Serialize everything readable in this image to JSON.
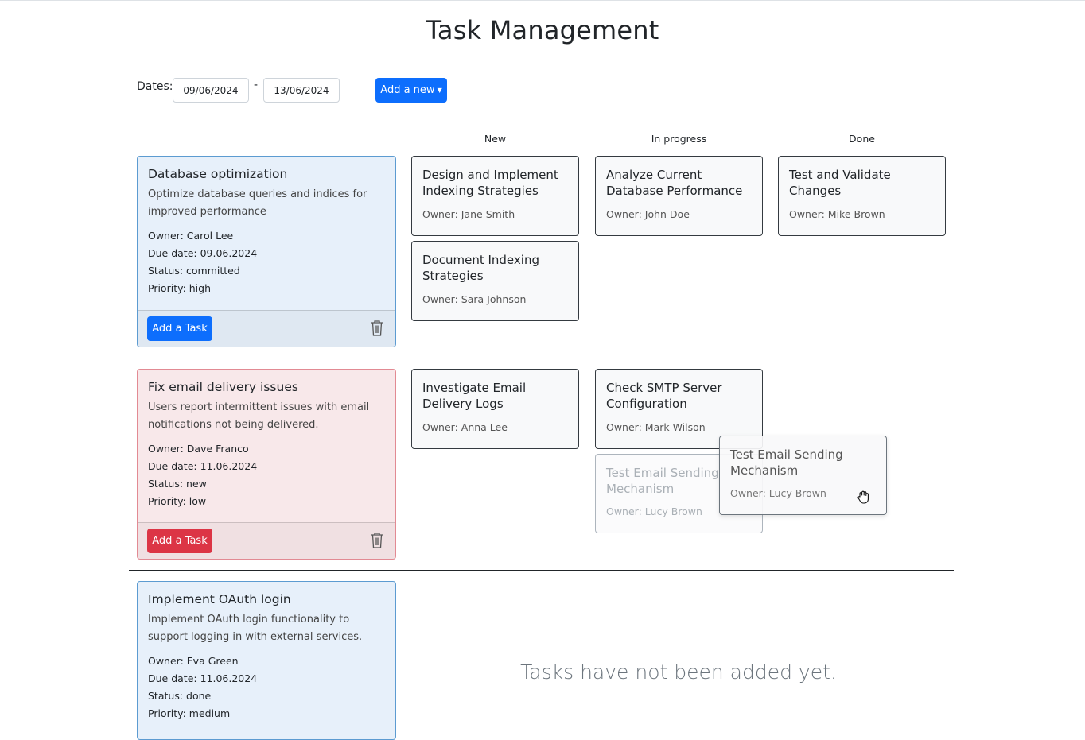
{
  "page": {
    "title": "Task Management"
  },
  "toolbar": {
    "dates_label": "Dates:",
    "date_from": "09/06/2024",
    "date_separator": "-",
    "date_to": "13/06/2024",
    "add_new_label": "Add a new"
  },
  "columns": [
    "New",
    "In progress",
    "Done"
  ],
  "stories": [
    {
      "title": "Database optimization",
      "description": "Optimize database queries and indices for improved performance",
      "owner": "Owner: Carol Lee",
      "due": "Due date: 09.06.2024",
      "status": "Status: committed",
      "priority": "Priority: high",
      "add_task_label": "Add a Task",
      "color": "#0d6efd"
    },
    {
      "title": "Fix email delivery issues",
      "description": "Users report intermittent issues with email notifications not being delivered.",
      "owner": "Owner: Dave Franco",
      "due": "Due date: 11.06.2024",
      "status": "Status: new",
      "priority": "Priority: low",
      "add_task_label": "Add a Task",
      "color": "#dc3545"
    },
    {
      "title": "Implement OAuth login",
      "description": "Implement OAuth login functionality to support logging in with external services.",
      "owner": "Owner: Eva Green",
      "due": "Due date: 11.06.2024",
      "status": "Status: done",
      "priority": "Priority: medium"
    }
  ],
  "tasks": {
    "s1_new_1": {
      "title": "Design and Implement Indexing Strategies",
      "owner": "Owner: Jane Smith"
    },
    "s1_new_2": {
      "title": "Document Indexing Strategies",
      "owner": "Owner: Sara Johnson"
    },
    "s1_progress_1": {
      "title": "Analyze Current Database Performance",
      "owner": "Owner: John Doe"
    },
    "s1_done_1": {
      "title": "Test and Validate Changes",
      "owner": "Owner: Mike Brown"
    },
    "s2_new_1": {
      "title": "Investigate Email Delivery Logs",
      "owner": "Owner: Anna Lee"
    },
    "s2_progress_1": {
      "title": "Check SMTP Server Configuration",
      "owner": "Owner: Mark Wilson"
    },
    "s2_progress_2": {
      "title": "Test Email Sending Mechanism",
      "owner": "Owner: Lucy Brown"
    },
    "dragging": {
      "title": "Test Email Sending Mechanism",
      "owner": "Owner: Lucy Brown"
    }
  },
  "empty_message": "Tasks have not been added yet.",
  "icons": {
    "trash": "trash-icon",
    "caret": "caret-down-icon",
    "grab": "grab-hand-icon"
  }
}
